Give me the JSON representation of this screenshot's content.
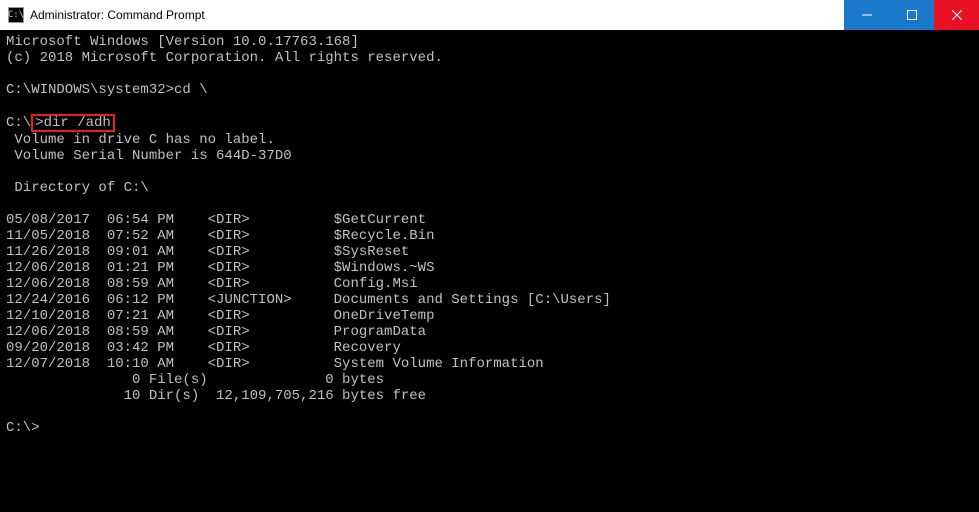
{
  "titlebar": {
    "icon_text": "C:\\",
    "title": "Administrator: Command Prompt"
  },
  "terminal": {
    "line1": "Microsoft Windows [Version 10.0.17763.168]",
    "line2": "(c) 2018 Microsoft Corporation. All rights reserved.",
    "prompt1_prefix": "C:\\WINDOWS\\system32>",
    "prompt1_cmd": "cd \\",
    "prompt2_prefix": "C:\\",
    "prompt2_highlight": ">dir /adh",
    "vol1": " Volume in drive C has no label.",
    "vol2": " Volume Serial Number is 644D-37D0",
    "dirof": " Directory of C:\\",
    "rows": [
      "05/08/2017  06:54 PM    <DIR>          $GetCurrent",
      "11/05/2018  07:52 AM    <DIR>          $Recycle.Bin",
      "11/26/2018  09:01 AM    <DIR>          $SysReset",
      "12/06/2018  01:21 PM    <DIR>          $Windows.~WS",
      "12/06/2018  08:59 AM    <DIR>          Config.Msi",
      "12/24/2016  06:12 PM    <JUNCTION>     Documents and Settings [C:\\Users]",
      "12/10/2018  07:21 AM    <DIR>          OneDriveTemp",
      "12/06/2018  08:59 AM    <DIR>          ProgramData",
      "09/20/2018  03:42 PM    <DIR>          Recovery",
      "12/07/2018  10:10 AM    <DIR>          System Volume Information"
    ],
    "summary1": "               0 File(s)              0 bytes",
    "summary2": "              10 Dir(s)  12,109,705,216 bytes free",
    "prompt3": "C:\\>"
  }
}
